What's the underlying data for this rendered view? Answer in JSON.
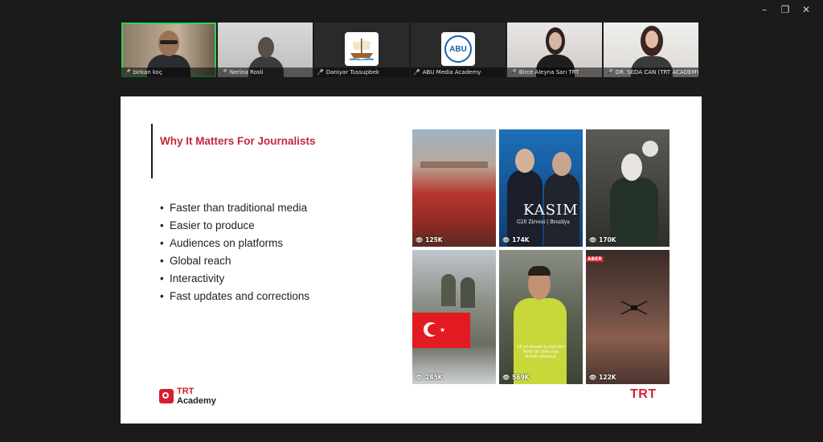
{
  "window_controls": {
    "minimize": "–",
    "restore": "❐",
    "close": "✕"
  },
  "participants": [
    {
      "name": "birkan koç",
      "mic": "mic-icon",
      "active": true
    },
    {
      "name": "Nerina Rosli",
      "mic": "mic-muted-icon"
    },
    {
      "name": "Daniyar Tussupbek",
      "mic": "mic-muted-icon"
    },
    {
      "name": "ABU Media Academy",
      "mic": "mic-muted-icon",
      "logo_text": "ABU"
    },
    {
      "name": "Birce Aleyna Sarı TRT",
      "mic": "mic-muted-icon"
    },
    {
      "name": "DR. SEDA CAN (TRT ACADEMY)",
      "mic": "mic-muted-icon"
    }
  ],
  "slide": {
    "title": "Why It Matters For Journalists",
    "bullets": [
      "Faster than traditional media",
      "Easier to produce",
      "Audiences on platforms",
      "Global reach",
      "Interactivity",
      "Fast updates and corrections"
    ],
    "videos": [
      {
        "views": "125K"
      },
      {
        "views": "174K",
        "overlay_title": "KASIM",
        "overlay_sub": "G20 Zirvesi | Brezilya"
      },
      {
        "views": "170K"
      },
      {
        "views": "285K"
      },
      {
        "views": "569K",
        "caption": "14 yıl önceki Suriye'den farklı bir ülke inşa etmek istiyoruz."
      },
      {
        "views": "122K",
        "badge": "ABER"
      }
    ],
    "logo_left": {
      "line1": "TRT",
      "line2": "Academy"
    },
    "logo_right": "TRT"
  },
  "colors": {
    "accent_red": "#c3283a",
    "brand_red": "#d81e2c",
    "active_green": "#2fd15a",
    "background": "#1b1b1b"
  }
}
